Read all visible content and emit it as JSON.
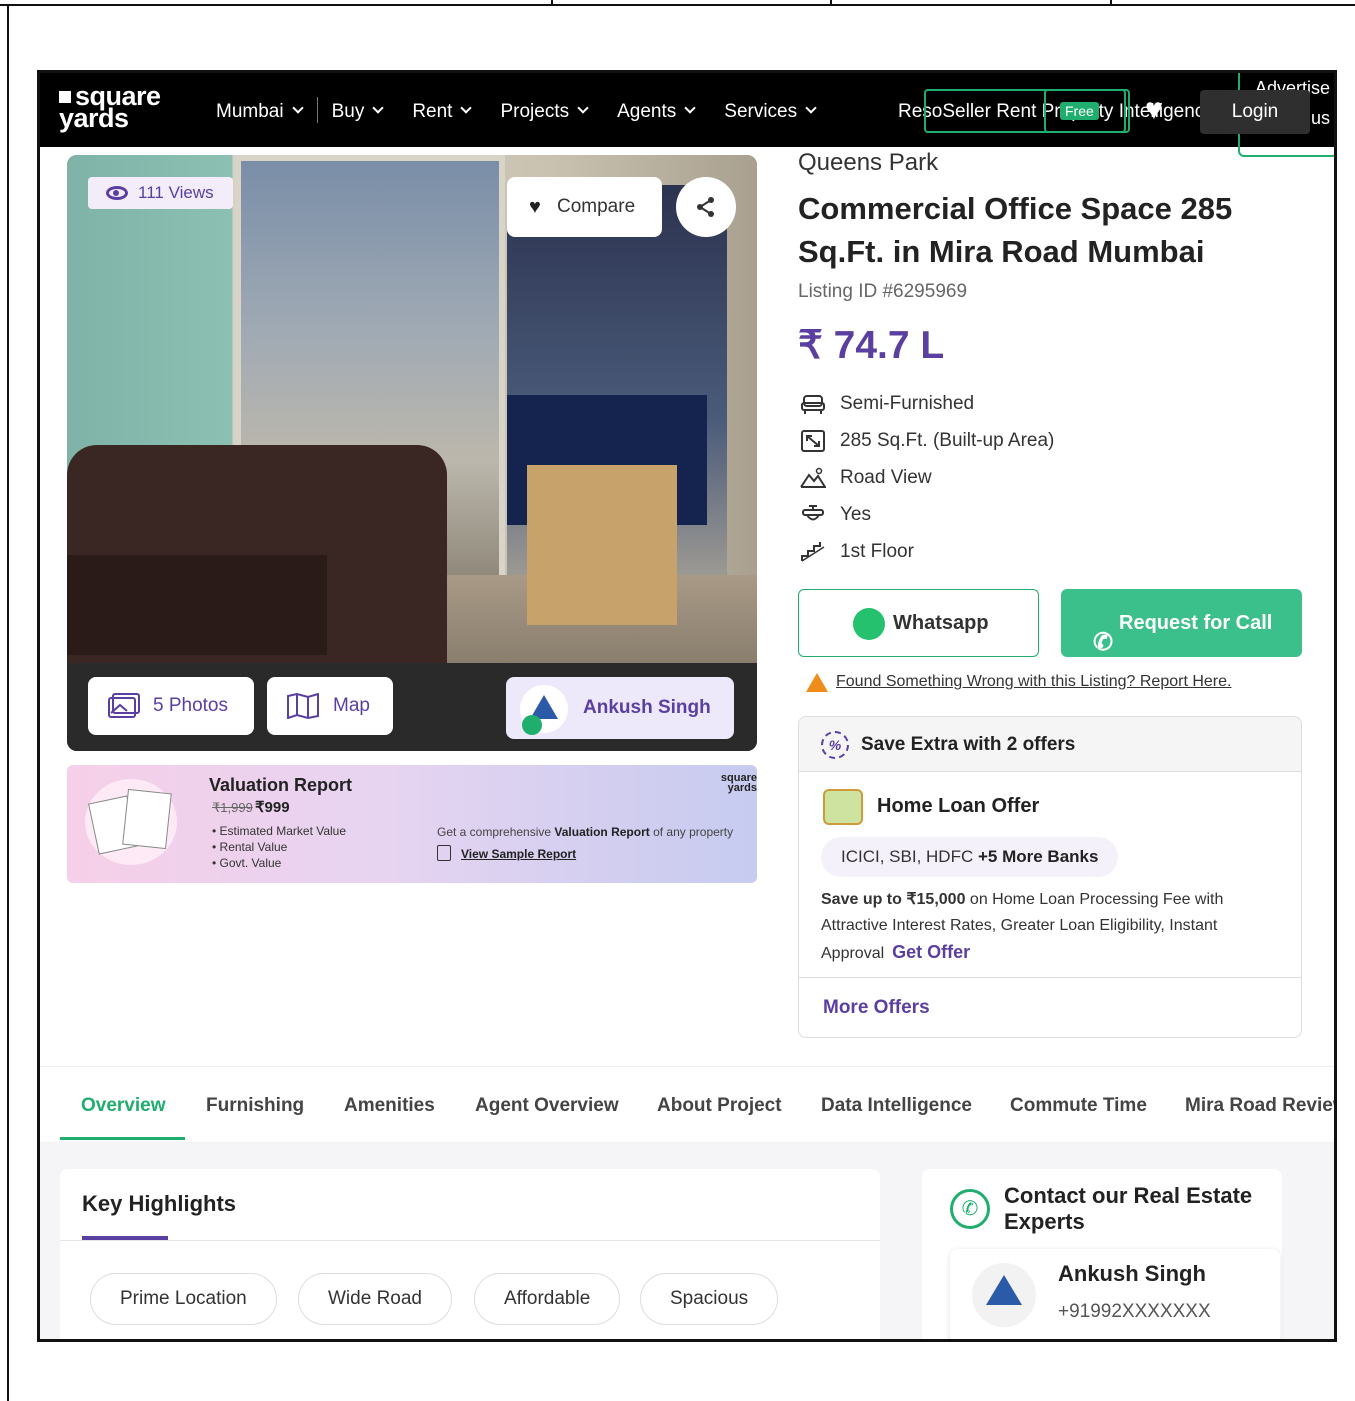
{
  "nav": {
    "logo_line1": "square",
    "logo_line2": "yards",
    "links": [
      "Mumbai",
      "Buy",
      "Rent",
      "Projects",
      "Agents",
      "Services"
    ],
    "overlap_text": "ResoSeller Rent Property Intelligence",
    "free_badge": "Free",
    "login": "Login",
    "advertise": "Advertise with us"
  },
  "gallery": {
    "views": "111 Views",
    "compare": "Compare",
    "photos": "5 Photos",
    "map": "Map",
    "agent": "Ankush Singh"
  },
  "valuation": {
    "title": "Valuation Report",
    "old_price": "₹1,999",
    "new_price": "₹999",
    "bullets": [
      "• Estimated Market Value",
      "• Rental Value",
      "• Govt. Value"
    ],
    "desc_pre": "Get a comprehensive ",
    "desc_bold": "Valuation Report",
    "desc_post": " of any property",
    "sample_link": "View Sample Report",
    "logo": "square yards"
  },
  "listing": {
    "project": "Queens Park",
    "title": "Commercial Office Space 285 Sq.Ft. in Mira Road Mumbai",
    "listing_id": "Listing ID #6295969",
    "price": "₹ 74.7 L",
    "features": [
      "Semi-Furnished",
      "285 Sq.Ft. (Built-up Area)",
      "Road View",
      "Yes",
      "1st Floor"
    ],
    "whatsapp": "Whatsapp",
    "request_call": "Request for Call",
    "report_link": "Found Something Wrong with this Listing? Report Here."
  },
  "offers": {
    "header": "Save Extra with 2 offers",
    "loan_title": "Home Loan Offer",
    "banks_pre": "ICICI, SBI, HDFC ",
    "banks_more": "+5 More Banks",
    "save_bold": "Save up to ₹15,000",
    "save_text": " on Home Loan Processing Fee with Attractive Interest Rates, Greater Loan Eligibility, Instant Approval",
    "get_offer": "Get Offer",
    "more_offers": "More Offers"
  },
  "tabs": [
    "Overview",
    "Furnishing",
    "Amenities",
    "Agent Overview",
    "About Project",
    "Data Intelligence",
    "Commute Time",
    "Mira Road Review"
  ],
  "highlights": {
    "title": "Key Highlights",
    "chips": [
      "Prime Location",
      "Wide Road",
      "Affordable",
      "Spacious"
    ]
  },
  "contact": {
    "title": "Contact our Real Estate Experts",
    "agent_name": "Ankush Singh",
    "phone": "+91992XXXXXXX"
  },
  "colors": {
    "brand_purple": "#5b3fa0",
    "accent_green": "#1fae6e",
    "nav_bg": "#000000"
  }
}
